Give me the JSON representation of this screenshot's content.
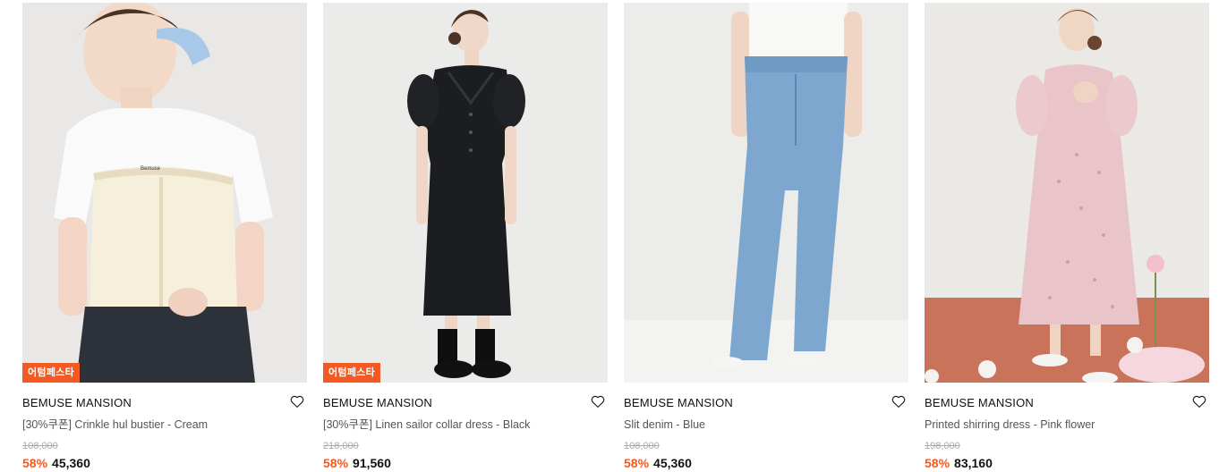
{
  "products": [
    {
      "brand": "BEMUSE MANSION",
      "name": "[30%쿠폰] Crinkle hul bustier - Cream",
      "original_price": "108,000",
      "discount": "58%",
      "price": "45,360",
      "badge": "어텀페스타",
      "image_icon": "product-photo"
    },
    {
      "brand": "BEMUSE MANSION",
      "name": "[30%쿠폰] Linen sailor collar dress - Black",
      "original_price": "218,000",
      "discount": "58%",
      "price": "91,560",
      "badge": "어텀페스타",
      "image_icon": "product-photo"
    },
    {
      "brand": "BEMUSE MANSION",
      "name": "Slit denim - Blue",
      "original_price": "108,000",
      "discount": "58%",
      "price": "45,360",
      "image_icon": "product-photo"
    },
    {
      "brand": "BEMUSE MANSION",
      "name": "Printed shirring dress - Pink flower",
      "original_price": "198,000",
      "discount": "58%",
      "price": "83,160",
      "image_icon": "product-photo"
    }
  ],
  "colors": {
    "accent": "#f15a22",
    "price": "#111111",
    "muted": "#aaaaaa"
  },
  "icons": {
    "wishlist": "heart-outline-icon"
  }
}
